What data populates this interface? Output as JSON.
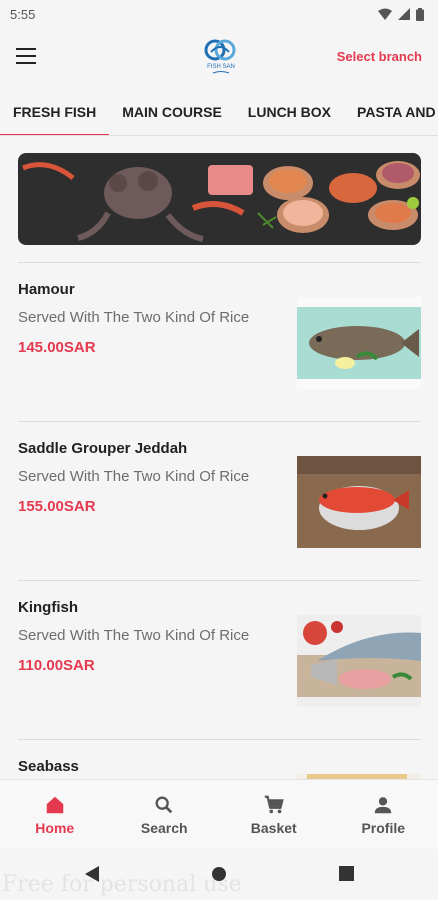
{
  "status": {
    "time": "5:55"
  },
  "header": {
    "select_branch": "Select branch",
    "logo_text": "FISH SAN"
  },
  "tabs": [
    "FRESH FISH",
    "MAIN COURSE",
    "LUNCH BOX",
    "PASTA AND R"
  ],
  "items": [
    {
      "name": "Hamour",
      "description": "Served With The Two Kind Of Rice",
      "price": "145.00SAR"
    },
    {
      "name": "Saddle Grouper Jeddah",
      "description": "Served With The Two Kind Of Rice",
      "price": "155.00SAR"
    },
    {
      "name": "Kingfish",
      "description": "Served With The Two Kind Of Rice",
      "price": "110.00SAR"
    },
    {
      "name": "Seabass",
      "description": "",
      "price": ""
    }
  ],
  "bottom_nav": {
    "home": "Home",
    "search": "Search",
    "basket": "Basket",
    "profile": "Profile"
  },
  "watermark": "Free for personal use",
  "colors": {
    "accent": "#e53950"
  }
}
